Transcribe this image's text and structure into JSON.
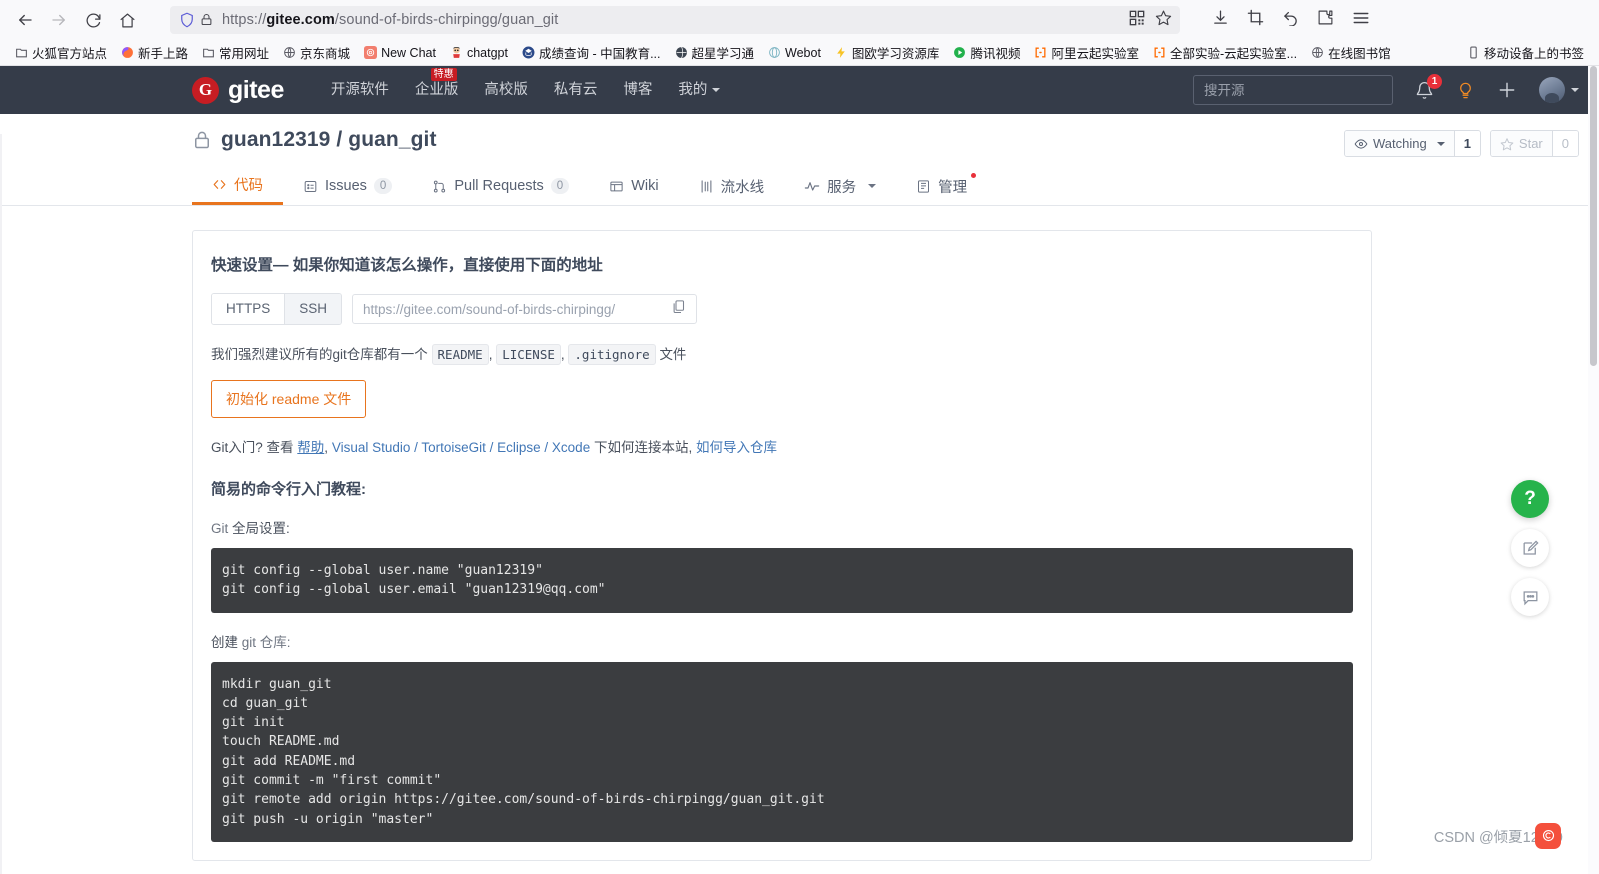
{
  "browser": {
    "url_prefix": "https://",
    "url_domain": "gitee.com",
    "url_path": "/sound-of-birds-chirpingg/guan_git",
    "url_full": "https://gitee.com/sound-of-birds-chirpingg/guan_git",
    "nav": {
      "back": "back-arrow",
      "forward": "forward-arrow",
      "reload": "reload",
      "home": "home"
    },
    "toolbar_right": [
      "download-icon",
      "screenshot-icon",
      "undo-icon",
      "extensions-icon",
      "menu-icon"
    ],
    "urlbar_right": [
      "qr-code-icon",
      "bookmark-star-icon"
    ],
    "bookmarks": [
      {
        "label": "火狐官方站点",
        "icon": "folder-icon"
      },
      {
        "label": "新手上路",
        "icon": "firefox-icon"
      },
      {
        "label": "常用网址",
        "icon": "folder-icon"
      },
      {
        "label": "京东商城",
        "icon": "globe-icon"
      },
      {
        "label": "New Chat",
        "icon": "openai-icon"
      },
      {
        "label": "chatgpt",
        "icon": "shinchan-icon"
      },
      {
        "label": "成绩查询 - 中国教育...",
        "icon": "edu-icon"
      },
      {
        "label": "超星学习通",
        "icon": "globe-dark-icon"
      },
      {
        "label": "Webot",
        "icon": "webot-icon"
      },
      {
        "label": "图欧学习资源库",
        "icon": "lightning-icon"
      },
      {
        "label": "腾讯视频",
        "icon": "play-icon"
      },
      {
        "label": "阿里云起实验室",
        "icon": "bracket-icon"
      },
      {
        "label": "全部实验-云起实验室...",
        "icon": "bracket-icon"
      },
      {
        "label": "在线图书馆",
        "icon": "globe-icon"
      }
    ],
    "bookmarks_right": {
      "label": "移动设备上的书签",
      "icon": "mobile-icon"
    }
  },
  "gitee": {
    "brand": {
      "mark": "G",
      "name": "gitee"
    },
    "nav": [
      {
        "label": "开源软件",
        "badge": ""
      },
      {
        "label": "企业版",
        "badge": "特惠"
      },
      {
        "label": "高校版",
        "badge": ""
      },
      {
        "label": "私有云",
        "badge": ""
      },
      {
        "label": "博客",
        "badge": ""
      },
      {
        "label": "我的",
        "badge": "",
        "has_caret": true
      }
    ],
    "search_placeholder": "搜开源",
    "notification_count": "1",
    "icons": [
      "bell-icon",
      "lightbulb-icon",
      "plus-icon",
      "avatar"
    ],
    "accent_color": "#e8741e",
    "header_bg": "#353c49",
    "brand_color": "#c71d23"
  },
  "repo": {
    "owner": "guan12319",
    "separator": "/",
    "name": "guan_git",
    "full": "guan12319 / guan_git",
    "visibility_icon": "lock-icon",
    "watch_label": "Watching",
    "watch_count": "1",
    "star_label": "Star",
    "star_count": "0",
    "tabs": [
      {
        "label": "代码",
        "icon": "code-icon",
        "count": "",
        "active": true
      },
      {
        "label": "Issues",
        "icon": "issue-icon",
        "count": "0",
        "active": false
      },
      {
        "label": "Pull Requests",
        "icon": "pr-icon",
        "count": "0",
        "active": false
      },
      {
        "label": "Wiki",
        "icon": "wiki-icon",
        "count": "",
        "active": false
      },
      {
        "label": "流水线",
        "icon": "pipeline-icon",
        "count": "",
        "active": false
      },
      {
        "label": "服务",
        "icon": "service-icon",
        "count": "",
        "active": false,
        "has_caret": true
      },
      {
        "label": "管理",
        "icon": "manage-icon",
        "count": "",
        "active": false,
        "has_dot": true
      }
    ]
  },
  "quickstart": {
    "title": "快速设置— 如果你知道该怎么操作，直接使用下面的地址",
    "protocols": [
      {
        "label": "HTTPS",
        "active": true
      },
      {
        "label": "SSH",
        "active": false
      }
    ],
    "clone_url": "https://gitee.com/sound-of-birds-chirpingg/",
    "copy_icon": "copy-icon",
    "recommend_prefix": "我们强烈建议所有的git仓库都有一个",
    "recommend_files": [
      "README",
      "LICENSE",
      ".gitignore"
    ],
    "recommend_suffix": "文件",
    "init_readme_button": "初始化 readme 文件",
    "git_help": {
      "lead": "Git入门?",
      "view": "查看",
      "help_link": "帮助",
      "ides": "Visual Studio / TortoiseGit / Eclipse / Xcode",
      "middle": "下如何连接本站,",
      "import_link": "如何导入仓库"
    },
    "tutorial_title": "简易的命令行入门教程:",
    "global_config_label_lead": "Git",
    "global_config_label": " 全局设置:",
    "global_config_code": "git config --global user.name \"guan12319\"\ngit config --global user.email \"guan12319@qq.com\"",
    "create_repo_label_lead": "创建",
    "create_repo_label": " git 仓库:",
    "create_repo_code": "mkdir guan_git\ncd guan_git\ngit init\ntouch README.md\ngit add README.md\ngit commit -m \"first commit\"\ngit remote add origin https://gitee.com/sound-of-birds-chirpingg/guan_git.git\ngit push -u origin \"master\""
  },
  "fabs": [
    {
      "icon": "help-icon",
      "label": "?",
      "style": "green"
    },
    {
      "icon": "feedback-edit-icon",
      "label": "",
      "style": "plain"
    },
    {
      "icon": "comment-icon",
      "label": "",
      "style": "plain"
    }
  ],
  "watermark": {
    "text": "CSDN @倾夏12319"
  }
}
